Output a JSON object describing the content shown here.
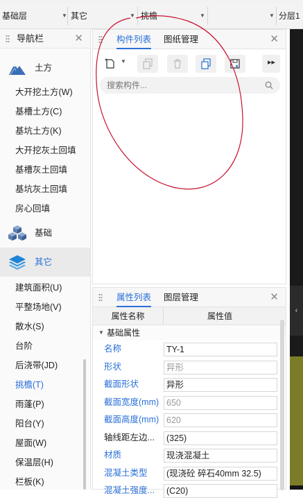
{
  "topbar": {
    "selects": [
      {
        "value": "基础层"
      },
      {
        "value": "其它"
      },
      {
        "value": "挑檐"
      },
      {
        "value": ""
      }
    ],
    "layer_label": "分层1"
  },
  "nav": {
    "title": "导航栏",
    "categories": [
      {
        "label": "土方",
        "icon": "mountain-icon",
        "items": [
          "大开挖土方(W)",
          "基槽土方(C)",
          "基坑土方(K)",
          "大开挖灰土回填",
          "基槽灰土回填",
          "基坑灰土回填",
          "房心回填"
        ]
      },
      {
        "label": "基础",
        "icon": "cubes-icon",
        "items": []
      },
      {
        "label": "其它",
        "icon": "layers-icon",
        "items": [
          "建筑面积(U)",
          "平整场地(V)",
          "散水(S)",
          "台阶",
          "后浇带(JD)",
          "挑檐(T)",
          "雨蓬(P)",
          "阳台(Y)",
          "屋面(W)",
          "保温层(H)",
          "栏板(K)"
        ]
      }
    ],
    "active_item": "挑檐(T)"
  },
  "component_panel": {
    "tabs": [
      "构件列表",
      "图纸管理"
    ],
    "search_placeholder": "搜索构件..."
  },
  "property_panel": {
    "tabs": [
      "属性列表",
      "图层管理"
    ],
    "col_name": "属性名称",
    "col_value": "属性值",
    "group": "基础属性",
    "rows": [
      {
        "name": "名称",
        "value": "TY-1",
        "blue": true,
        "gray": false
      },
      {
        "name": "形状",
        "value": "异形",
        "blue": true,
        "gray": true
      },
      {
        "name": "截面形状",
        "value": "异形",
        "blue": true,
        "gray": false
      },
      {
        "name": "截面宽度(mm)",
        "value": "650",
        "blue": true,
        "gray": true
      },
      {
        "name": "截面高度(mm)",
        "value": "620",
        "blue": true,
        "gray": true
      },
      {
        "name": "轴线距左边...",
        "value": "(325)",
        "blue": false,
        "gray": false
      },
      {
        "name": "材质",
        "value": "现浇混凝土",
        "blue": true,
        "gray": false
      },
      {
        "name": "混凝土类型",
        "value": "(现浇砼 碎石40mm 32.5)",
        "blue": true,
        "gray": false
      },
      {
        "name": "混凝土强度...",
        "value": "(C20)",
        "blue": true,
        "gray": false
      }
    ]
  },
  "colors": {
    "accent": "#2a6fd8",
    "annotation": "#c8102e"
  }
}
